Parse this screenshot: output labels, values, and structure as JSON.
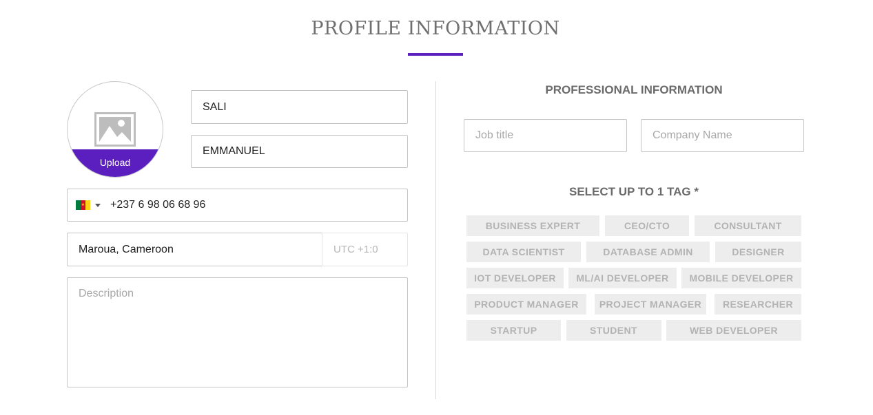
{
  "page": {
    "title": "PROFILE INFORMATION"
  },
  "avatar": {
    "upload_label": "Upload",
    "icon": "image-placeholder-icon"
  },
  "personal": {
    "first_name": "SALI",
    "last_name": "EMMANUEL",
    "phone": {
      "country_flag": "cameroon-flag-icon",
      "number": "+237 6 98 06 68 96"
    },
    "location": "Maroua, Cameroon",
    "timezone": "UTC +1:0",
    "description_placeholder": "Description"
  },
  "professional": {
    "heading": "PROFESSIONAL INFORMATION",
    "job_title_placeholder": "Job title",
    "company_name_placeholder": "Company Name"
  },
  "tags": {
    "heading": "SELECT UP TO 1 TAG *",
    "rows": [
      [
        "BUSINESS EXPERT",
        "CEO/CTO",
        "CONSULTANT"
      ],
      [
        "DATA SCIENTIST",
        "DATABASE ADMIN",
        "DESIGNER"
      ],
      [
        "IOT DEVELOPER",
        "ML/AI DEVELOPER",
        "MOBILE DEVELOPER"
      ],
      [
        "PRODUCT MANAGER",
        "PROJECT MANAGER",
        "RESEARCHER"
      ],
      [
        "STARTUP",
        "STUDENT",
        "WEB DEVELOPER"
      ]
    ]
  },
  "colors": {
    "accent": "#5b1fbf",
    "tag_bg": "#ededed",
    "tag_text": "#b3b3b3",
    "flag_green": "#007a3d",
    "flag_red": "#ce1126",
    "flag_yellow": "#fcd116"
  }
}
